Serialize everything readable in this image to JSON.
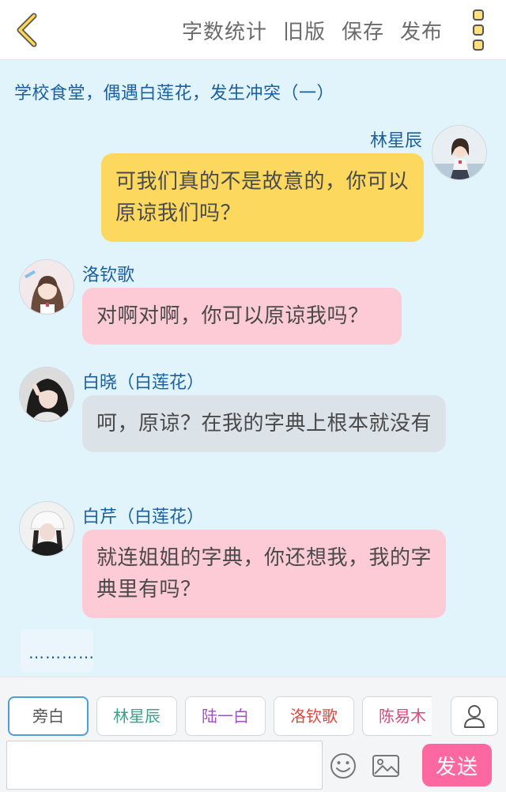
{
  "header": {
    "actions": [
      "字数统计",
      "旧版",
      "保存",
      "发布"
    ]
  },
  "chapter_title": "学校食堂，偶遇白莲花，发生冲突（一）",
  "messages": [
    {
      "name": "林星辰",
      "text": "可我们真的不是故意的，你可以原谅我们吗？",
      "side": "right",
      "color": "#fcd95e"
    },
    {
      "name": "洛钦歌",
      "text": "对啊对啊，你可以原谅我吗？",
      "side": "left",
      "color": "#fccbd6"
    },
    {
      "name": "白晓（白莲花）",
      "text": "呵，原谅？在我的字典上根本就没有",
      "side": "left",
      "color": "#dbe2e8"
    },
    {
      "name": "白芹（白莲花）",
      "text": "就连姐姐的字典，你还想我，我的字典里有吗？",
      "side": "left",
      "color": "#fccbd6"
    }
  ],
  "typing_indicator": "…………",
  "roles": [
    {
      "label": "旁白",
      "color": "#555555"
    },
    {
      "label": "林星辰",
      "color": "#3aa38a"
    },
    {
      "label": "陆一白",
      "color": "#a14fc4"
    },
    {
      "label": "洛钦歌",
      "color": "#e0453a"
    },
    {
      "label": "陈易木",
      "color": "#e0467a"
    }
  ],
  "composer": {
    "placeholder": "",
    "send_label": "发送"
  },
  "colors": {
    "background": "#e2f4fb",
    "name_text": "#1c5fa0",
    "send_button": "#fd68a0",
    "more_dots": "#ffe07a"
  }
}
